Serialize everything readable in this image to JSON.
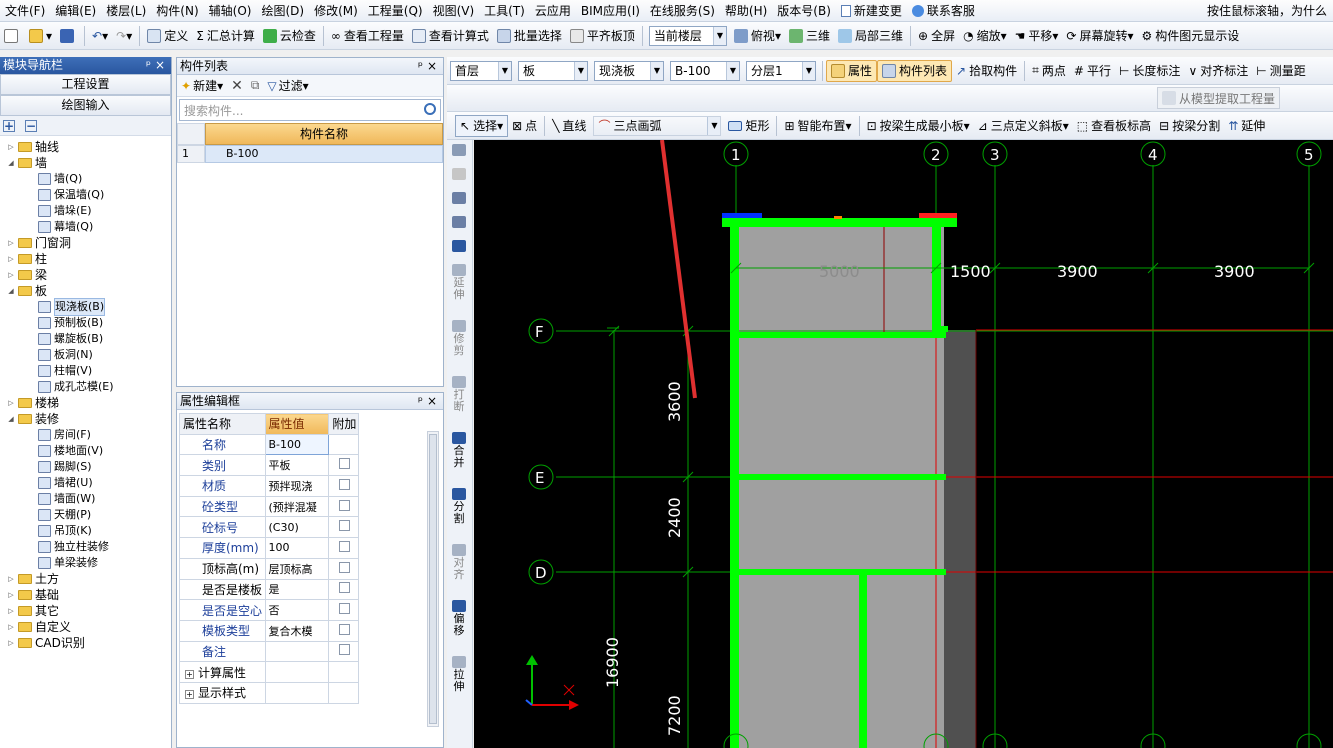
{
  "menu": {
    "items": [
      "文件(F)",
      "编辑(E)",
      "楼层(L)",
      "构件(N)",
      "辅轴(O)",
      "绘图(D)",
      "修改(M)",
      "工程量(Q)",
      "视图(V)",
      "工具(T)",
      "云应用",
      "BIM应用(I)",
      "在线服务(S)",
      "帮助(H)",
      "版本号(B)"
    ],
    "new_change": "新建变更",
    "contact": "联系客服",
    "tip": "按住鼠标滚轴，为什么"
  },
  "toolbar1": {
    "define": "定义",
    "sum_calc": "汇总计算",
    "cloud_check": "云检查",
    "view_quantity": "查看工程量",
    "view_formula": "查看计算式",
    "batch_select": "批量选择",
    "align_top": "平齐板顶",
    "current_floor": "当前楼层",
    "top_view": "俯视",
    "three_d": "三维",
    "local_3d": "局部三维",
    "full_screen": "全屏",
    "zoom": "缩放",
    "pan": "平移",
    "rotate": "屏幕旋转",
    "elem_display": "构件图元显示设"
  },
  "toolbar2": {
    "floor": "首层",
    "category": "板",
    "type": "现浇板",
    "name": "B-100",
    "layer": "分层1",
    "property": "属性",
    "comp_list": "构件列表",
    "pick": "拾取构件",
    "two_points": "两点",
    "parallel": "平行",
    "length_dim": "长度标注",
    "align_dim": "对齐标注",
    "measure": "测量距"
  },
  "toolbar3": {
    "extract": "从模型提取工程量"
  },
  "toolbar4": {
    "select": "选择",
    "point": "点",
    "line": "直线",
    "arc": "三点画弧",
    "rect": "矩形",
    "smart": "智能布置",
    "beam_min": "按梁生成最小板",
    "slope": "三点定义斜板",
    "view_height": "查看板标高",
    "beam_split": "按梁分割",
    "extend": "延伸"
  },
  "nav": {
    "title": "模块导航栏",
    "tab1": "工程设置",
    "tab2": "绘图输入",
    "tree": [
      {
        "label": "轴线",
        "level": 0,
        "kind": "folder",
        "open": false
      },
      {
        "label": "墙",
        "level": 0,
        "kind": "folder",
        "open": true
      },
      {
        "label": "墙(Q)",
        "level": 1,
        "kind": "leaf"
      },
      {
        "label": "保温墙(Q)",
        "level": 1,
        "kind": "leaf"
      },
      {
        "label": "墙垛(E)",
        "level": 1,
        "kind": "leaf"
      },
      {
        "label": "幕墙(Q)",
        "level": 1,
        "kind": "leaf"
      },
      {
        "label": "门窗洞",
        "level": 0,
        "kind": "folder",
        "open": false
      },
      {
        "label": "柱",
        "level": 0,
        "kind": "folder",
        "open": false
      },
      {
        "label": "梁",
        "level": 0,
        "kind": "folder",
        "open": false
      },
      {
        "label": "板",
        "level": 0,
        "kind": "folder",
        "open": true
      },
      {
        "label": "现浇板(B)",
        "level": 1,
        "kind": "leaf",
        "selected": true
      },
      {
        "label": "预制板(B)",
        "level": 1,
        "kind": "leaf"
      },
      {
        "label": "螺旋板(B)",
        "level": 1,
        "kind": "leaf"
      },
      {
        "label": "板洞(N)",
        "level": 1,
        "kind": "leaf"
      },
      {
        "label": "柱帽(V)",
        "level": 1,
        "kind": "leaf"
      },
      {
        "label": "成孔芯模(E)",
        "level": 1,
        "kind": "leaf"
      },
      {
        "label": "楼梯",
        "level": 0,
        "kind": "folder",
        "open": false
      },
      {
        "label": "装修",
        "level": 0,
        "kind": "folder",
        "open": true
      },
      {
        "label": "房间(F)",
        "level": 1,
        "kind": "leaf"
      },
      {
        "label": "楼地面(V)",
        "level": 1,
        "kind": "leaf"
      },
      {
        "label": "踢脚(S)",
        "level": 1,
        "kind": "leaf"
      },
      {
        "label": "墙裙(U)",
        "level": 1,
        "kind": "leaf"
      },
      {
        "label": "墙面(W)",
        "level": 1,
        "kind": "leaf"
      },
      {
        "label": "天棚(P)",
        "level": 1,
        "kind": "leaf"
      },
      {
        "label": "吊顶(K)",
        "level": 1,
        "kind": "leaf"
      },
      {
        "label": "独立柱装修",
        "level": 1,
        "kind": "leaf"
      },
      {
        "label": "单梁装修",
        "level": 1,
        "kind": "leaf"
      },
      {
        "label": "土方",
        "level": 0,
        "kind": "folder",
        "open": false
      },
      {
        "label": "基础",
        "level": 0,
        "kind": "folder",
        "open": false
      },
      {
        "label": "其它",
        "level": 0,
        "kind": "folder",
        "open": false
      },
      {
        "label": "自定义",
        "level": 0,
        "kind": "folder",
        "open": false
      },
      {
        "label": "CAD识别",
        "level": 0,
        "kind": "folder",
        "open": false
      }
    ]
  },
  "comp_list": {
    "title": "构件列表",
    "new": "新建",
    "filter": "过滤",
    "search_placeholder": "搜索构件...",
    "column": "构件名称",
    "rows": [
      {
        "num": "1",
        "name": "B-100"
      }
    ]
  },
  "prop_editor": {
    "title": "属性编辑框",
    "headers": [
      "属性名称",
      "属性值",
      "附加"
    ],
    "rows": [
      {
        "name": "名称",
        "value": "B-100",
        "check": false,
        "blue": true
      },
      {
        "name": "类别",
        "value": "平板",
        "check": true,
        "blue": true
      },
      {
        "name": "材质",
        "value": "预拌现浇",
        "check": true,
        "blue": true
      },
      {
        "name": "砼类型",
        "value": "(预拌混凝",
        "check": true,
        "blue": true
      },
      {
        "name": "砼标号",
        "value": "(C30)",
        "check": true,
        "blue": true
      },
      {
        "name": "厚度(mm)",
        "value": "100",
        "check": true,
        "blue": true
      },
      {
        "name": "顶标高(m)",
        "value": "层顶标高",
        "check": true,
        "blue": false
      },
      {
        "name": "是否是楼板",
        "value": "是",
        "check": true,
        "blue": false
      },
      {
        "name": "是否是空心",
        "value": "否",
        "check": true,
        "blue": true
      },
      {
        "name": "模板类型",
        "value": "复合木模",
        "check": true,
        "blue": true
      },
      {
        "name": "备注",
        "value": "",
        "check": true,
        "blue": true
      }
    ],
    "groups": [
      "计算属性",
      "显示样式"
    ]
  },
  "vtools": [
    "延伸",
    "修剪",
    "打断",
    "合并",
    "分割",
    "对齐",
    "偏移",
    "拉伸"
  ],
  "canvas": {
    "top_axes": [
      "1",
      "2",
      "3",
      "4",
      "5"
    ],
    "left_axes": [
      "F",
      "E",
      "D"
    ],
    "dims_top": [
      "5000",
      "1500",
      "3900",
      "3900"
    ],
    "dims_left": [
      "3600",
      "2400",
      "16900",
      "7200"
    ],
    "colors": {
      "axis": "#00a000",
      "slab": "#a0a0a0",
      "wall": "#00ff00",
      "dim": "#ffffff",
      "red": "#e00000"
    }
  }
}
